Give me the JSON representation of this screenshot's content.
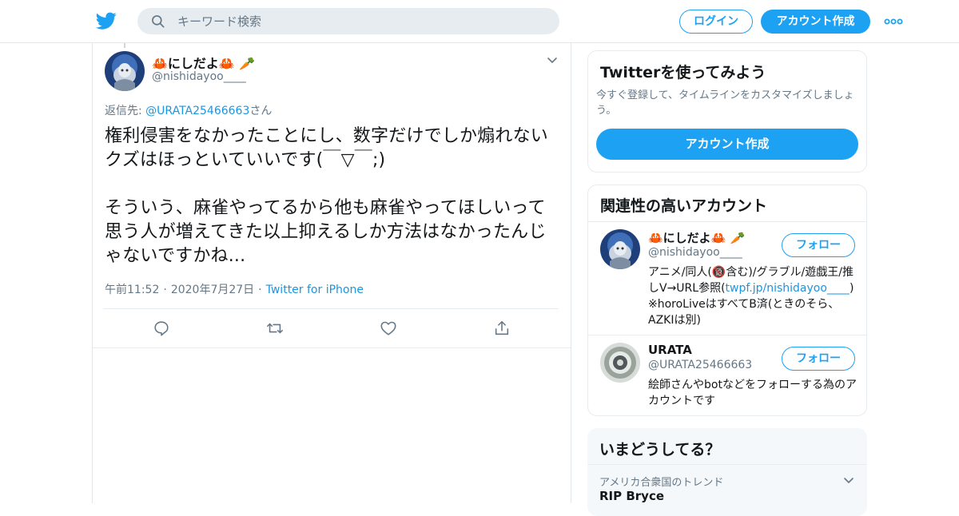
{
  "header": {
    "search_placeholder": "キーワード検索",
    "login_label": "ログイン",
    "signup_label": "アカウント作成"
  },
  "tweet": {
    "display_name": "🦀にしだよ🦀 🥕",
    "handle": "@nishidayoo____",
    "reply_prefix": "返信先: ",
    "reply_mention": "@URATA25466663",
    "reply_suffix": "さん",
    "text": "権利侵害をなかったことにし、数字だけでしか煽れないクズはほっといていいです(￣▽￣;)\n\nそういう、麻雀やってるから他も麻雀やってほしいって思う人が増えてきた以上抑えるしか方法はなかったんじゃないですかね...",
    "time": "午前11:52",
    "date": "2020年7月27日",
    "source": "Twitter for iPhone"
  },
  "sidebar": {
    "signup_card": {
      "title": "Twitterを使ってみよう",
      "description": "今すぐ登録して、タイムラインをカスタマイズしましょう。",
      "button_label": "アカウント作成"
    },
    "related": {
      "title": "関連性の高いアカウント",
      "accounts": [
        {
          "name": "🦀にしだよ🦀 🥕",
          "handle": "@nishidayoo____",
          "bio_1": "アニメ/同人(🔞含む)/グラブル/遊戯王/推しV→URL参照(",
          "bio_link": "twpf.jp/nishidayoo____",
          "bio_2": ") ※horoLiveはすべてB済(ときのそら、AZKIは別)",
          "follow_label": "フォロー"
        },
        {
          "name": "URATA",
          "handle": "@URATA25466663",
          "bio": "絵師さんやbotなどをフォローする為のアカウントです",
          "follow_label": "フォロー"
        }
      ]
    },
    "trends": {
      "title": "いまどうしてる？",
      "context": "アメリカ合衆国のトレンド",
      "trend_name": "RIP Bryce"
    }
  },
  "colors": {
    "brand": "#1da1f2",
    "link": "#1b95e0",
    "secondary_text": "#657786",
    "border": "#e6ecf0"
  }
}
